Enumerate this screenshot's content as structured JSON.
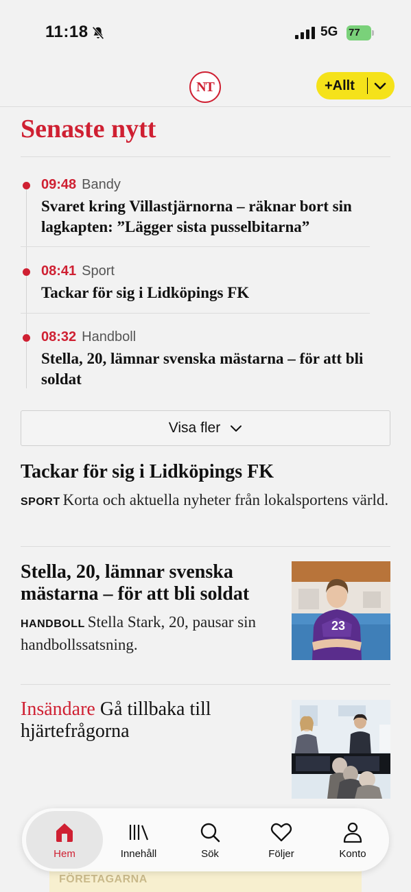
{
  "status_bar": {
    "time": "11:18",
    "network": "5G",
    "battery": "77"
  },
  "header": {
    "logo_text": "NT",
    "filter_button": "+Allt"
  },
  "latest": {
    "title": "Senaste nytt",
    "items": [
      {
        "time": "09:48",
        "category": "Bandy",
        "headline": "Svaret kring Villastjärnorna – räknar bort sin lagkapten: ”Lägger sista pusselbitarna”"
      },
      {
        "time": "08:41",
        "category": "Sport",
        "headline": "Tackar för sig i Lidköpings FK"
      },
      {
        "time": "08:32",
        "category": "Handboll",
        "headline": "Stella, 20, lämnar svenska mästarna – för att bli soldat"
      }
    ],
    "more_button": "Visa fler"
  },
  "articles": [
    {
      "headline": "Tackar för sig i Lidköpings FK",
      "kicker": "SPORT",
      "summary": "Korta och aktuella nyheter från lokalsportens värld."
    },
    {
      "headline": "Stella, 20, lämnar svenska mästarna – för att bli soldat",
      "kicker": "HANDBOLL",
      "summary": "Stella Stark, 20, pausar sin handbollssatsning.",
      "jersey_number": "23"
    },
    {
      "label": "Insändare",
      "headline": "Gå tillbaka till hjärtefrågorna"
    }
  ],
  "bottom_nav": {
    "items": [
      {
        "label": "Hem",
        "icon": "home-icon",
        "active": true
      },
      {
        "label": "Innehåll",
        "icon": "library-icon"
      },
      {
        "label": "Sök",
        "icon": "search-icon"
      },
      {
        "label": "Följer",
        "icon": "heart-icon"
      },
      {
        "label": "Konto",
        "icon": "account-icon"
      }
    ]
  },
  "ad": {
    "text": "FÖRETAGARNA"
  },
  "colors": {
    "brand_red": "#cf2032",
    "accent_yellow": "#f5e21a",
    "background": "#f2f2f2"
  }
}
